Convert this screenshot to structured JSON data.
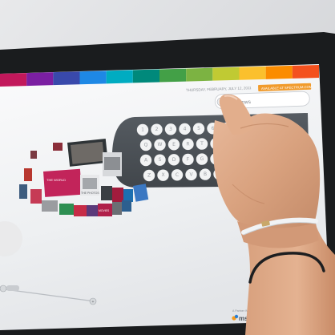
{
  "photo": {
    "subject": "Hand touching a large touchscreen kiosk showing an on-screen keyboard and a 3D carousel of images"
  },
  "screen": {
    "header_date": "THURSDAY, FEBRUARY, JULY 12, 2011",
    "header_badge": "AVAILABLE AT SPECTRUM.COM",
    "search_field_text": "NBC NEWS",
    "keyboard": {
      "rows": [
        [
          "1",
          "2",
          "3",
          "4",
          "5",
          "6",
          "7"
        ],
        [
          "Q",
          "W",
          "E",
          "R",
          "T",
          "Y",
          "U"
        ],
        [
          "A",
          "S",
          "D",
          "F",
          "G",
          "H",
          "J"
        ],
        [
          "Z",
          "X",
          "C",
          "V",
          "B",
          "N",
          "M"
        ]
      ]
    },
    "carousel_captions": [
      "THE WORLD",
      "THE PHOTOS",
      "MOVIES"
    ],
    "footer_caption": "A Partner With",
    "footer_logo": "msn",
    "colors": {
      "rainbow": [
        "#c2185b",
        "#7b1fa2",
        "#3949ab",
        "#1e88e5",
        "#00acc1",
        "#00897b",
        "#43a047",
        "#7cb342",
        "#c0ca33",
        "#fbc02d",
        "#fb8c00",
        "#f4511e"
      ],
      "keyboard_panel": "#4d5358",
      "key_face": "#f2f3f4",
      "screen_bg": "#f4f5f7",
      "bezel": "#1a1c1e"
    }
  }
}
